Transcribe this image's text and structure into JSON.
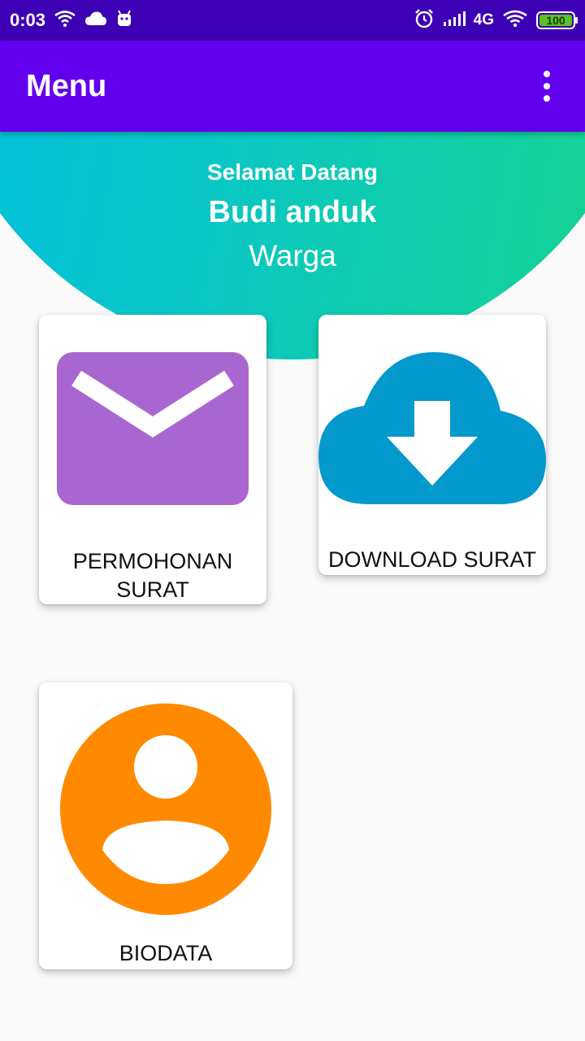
{
  "status_bar": {
    "time": "0:03",
    "network": "4G",
    "battery": "100",
    "icons": [
      "wifi-call-icon",
      "cloud-icon",
      "android-icon",
      "alarm-icon",
      "signal-icon",
      "wifi-icon",
      "battery-icon"
    ]
  },
  "app_bar": {
    "title": "Menu",
    "overflow_icon": "more-vert-icon"
  },
  "header": {
    "greeting": "Selamat Datang",
    "name": "Budi anduk",
    "role": "Warga"
  },
  "menu": {
    "items": [
      {
        "label_line1": "PERMOHONAN",
        "label_line2": "SURAT",
        "icon": "mail-icon",
        "color": "#a966d0"
      },
      {
        "label": "DOWNLOAD SURAT",
        "icon": "cloud-download-icon",
        "color": "#0399cc"
      },
      {
        "label": "BIODATA",
        "icon": "account-circle-icon",
        "color": "#ff8a00"
      }
    ]
  },
  "colors": {
    "status_bar": "#3d00b4",
    "app_bar": "#6200ee",
    "header_gradient_start": "#00bde6",
    "header_gradient_end": "#17d58a",
    "background": "#fafafa"
  }
}
